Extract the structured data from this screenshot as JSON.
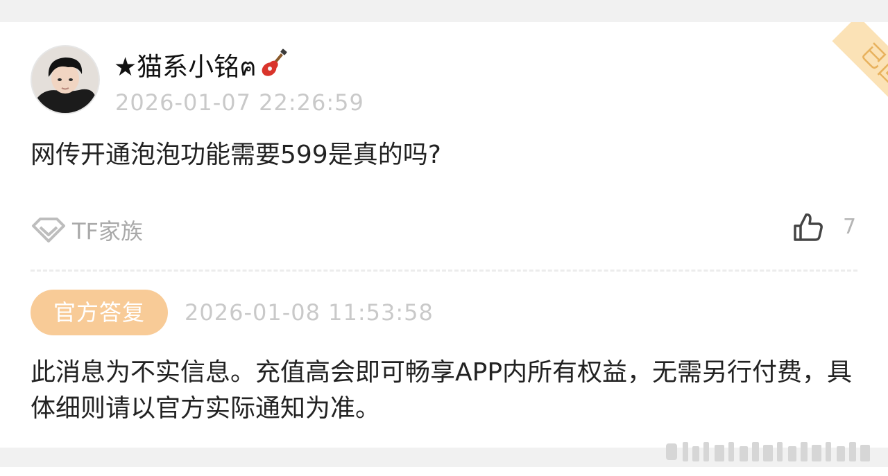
{
  "question": {
    "author": {
      "name": "★猫系小铭ฅ",
      "avatar_icon": "user-avatar-photo",
      "emoji_icon": "guitar-emoji"
    },
    "timestamp": "2026-01-07 22:26:59",
    "text": "网传开通泡泡功能需要599是真的吗?",
    "replied_stamp": "已回复",
    "tag": {
      "icon": "diamond-icon",
      "label": "TF家族"
    },
    "likes": {
      "icon": "thumbs-up-icon",
      "count": "7"
    }
  },
  "answer": {
    "badge": "官方答复",
    "timestamp": "2026-01-08 11:53:58",
    "text": "此消息为不实信息。充值高会即可畅享APP内所有权益，无需另行付费，具体细则请以官方实际通知为准。"
  },
  "colors": {
    "accent": "#f8cb97",
    "stamp": "#e8b25e",
    "muted": "#c9c9c9"
  }
}
